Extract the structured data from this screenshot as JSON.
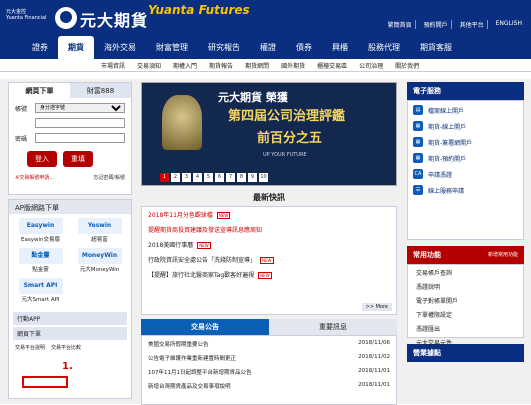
{
  "header": {
    "small_logo": [
      "元大金控",
      "Yuanta Financial"
    ],
    "brand_cn": "元大期貨",
    "brand_en": "Yuanta Futures",
    "links": [
      "繁簡首頁",
      "預約開戶",
      "其他平台",
      "ENGLISH"
    ]
  },
  "nav": {
    "items": [
      "證券",
      "期貨",
      "海外交易",
      "財富管理",
      "研究報告",
      "權證",
      "債券",
      "興櫃",
      "股務代理",
      "期貨客服"
    ],
    "active": "期貨"
  },
  "subnav": {
    "items": [
      "市場資訊",
      "交易須知",
      "期權入門",
      "期貨報告",
      "期貨網問",
      "國外期貨",
      "櫃檯交易區",
      "公司治理",
      "關於我們"
    ]
  },
  "login": {
    "tabs": [
      "網頁下單",
      "財富888"
    ],
    "id_type_label": "帳號",
    "id_type_value": "身分證字號",
    "password_label": "密碼",
    "login_btn": "登入",
    "reset_btn": "重填",
    "link_left": "※交易帳號申請...",
    "link_right": "忘記密碼/帳號"
  },
  "apps": {
    "title": "AP版網路下單",
    "tiles": [
      {
        "img": "Easywin",
        "label": "Easywin交易版"
      },
      {
        "img": "Yeswin",
        "label": "超易富"
      },
      {
        "img": "點金靈",
        "label": "點金靈"
      },
      {
        "img": "MoneyWin",
        "label": "元大MoneyWin"
      },
      {
        "img": "Smart API",
        "label": "元大Smart API"
      }
    ],
    "mobile": "行動APP",
    "web": "網頁下單",
    "bottom_left": "交易平台說明",
    "bottom_right": "交易平台比較",
    "annotation": "1."
  },
  "banner": {
    "title": "元大期貨 榮獲",
    "mid": "第四屆公司治理評鑑",
    "sub": "前百分之五",
    "en": "UP YOUR FUTURE",
    "pages": [
      "1",
      "2",
      "3",
      "4",
      "5",
      "6",
      "7",
      "8",
      "9",
      "10"
    ]
  },
  "news": {
    "title": "最新快訊",
    "items": [
      {
        "text": "2018年11月分色觀球檔",
        "red": true,
        "new": true
      },
      {
        "text": "提醒期貨商投資建議及發送宣導訊息應周知",
        "red": true,
        "new": false
      },
      {
        "text": "2018美國行事曆",
        "red": false,
        "new": true
      },
      {
        "text": "行政院資訊安全處公告「洗錢防制宣導」",
        "red": false,
        "new": true
      },
      {
        "text": "【提醒】旅行社北醫商家Tag歡客好遍視",
        "red": false,
        "new": true
      }
    ],
    "more": ">> More"
  },
  "announce": {
    "tabs": [
      "交易公告",
      "重要訊息"
    ],
    "items": [
      {
        "text": "美國交易所假期重要公告",
        "date": "2018/11/06"
      },
      {
        "text": "公告電子維護作業重新建置時間更正",
        "date": "2018/11/02"
      },
      {
        "text": "107年11月1日起調整平台新增期貨品公告",
        "date": "2018/11/01"
      },
      {
        "text": "新增台灣期貨產品及交易事項說明",
        "date": "2018/11/01"
      }
    ]
  },
  "services": {
    "title": "電子服務",
    "items": [
      {
        "icon": "form-icon",
        "label": "檔案線上開戶"
      },
      {
        "icon": "doc-icon",
        "label": "期貨-線上開戶"
      },
      {
        "icon": "doc-icon",
        "label": "期貨-簽署網開戶"
      },
      {
        "icon": "doc-icon",
        "label": "期貨-預約開戶"
      },
      {
        "icon": "ca-icon",
        "label": "申請憑證"
      },
      {
        "icon": "list-icon",
        "label": "線上服務申請"
      }
    ]
  },
  "common": {
    "title": "常用功能",
    "link": "新增常用功能",
    "items": [
      "交易帳戶查詢",
      "憑證說明",
      "電子對帳單開戶",
      "下單權限設定",
      "憑證匯出",
      "元大交易元件"
    ]
  },
  "branch": {
    "title": "營業據點"
  }
}
